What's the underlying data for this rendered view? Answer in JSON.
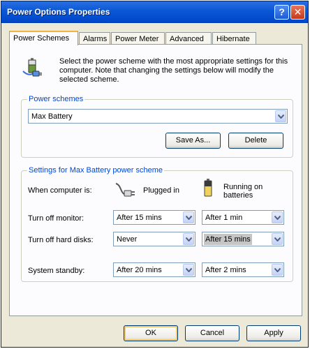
{
  "window": {
    "title": "Power Options Properties",
    "help_glyph": "?",
    "close_glyph": "✕"
  },
  "tabs": [
    {
      "label": "Power Schemes",
      "active": true
    },
    {
      "label": "Alarms"
    },
    {
      "label": "Power Meter"
    },
    {
      "label": "Advanced"
    },
    {
      "label": "Hibernate"
    }
  ],
  "description": "Select the power scheme with the most appropriate settings for this computer. Note that changing the settings below will modify the selected scheme.",
  "power_schemes": {
    "legend": "Power schemes",
    "selected": "Max Battery",
    "save_as_label": "Save As...",
    "delete_label": "Delete"
  },
  "settings": {
    "legend": "Settings for Max Battery power scheme",
    "when_label": "When computer is:",
    "plugged_in_label": "Plugged in",
    "running_on_batteries_label": "Running on batteries",
    "rows": [
      {
        "label": "Turn off monitor:",
        "plugged": "After 15 mins",
        "battery": "After 1 min"
      },
      {
        "label": "Turn off hard disks:",
        "plugged": "Never",
        "battery": "After 15 mins"
      },
      {
        "label": "System standby:",
        "plugged": "After 20 mins",
        "battery": "After 2 mins"
      }
    ]
  },
  "footer": {
    "ok_label": "OK",
    "cancel_label": "Cancel",
    "apply_label": "Apply"
  },
  "colors": {
    "title_bar": "#0a57d6",
    "accent_blue": "#0046d5",
    "tab_active_top": "#f3b33d"
  }
}
